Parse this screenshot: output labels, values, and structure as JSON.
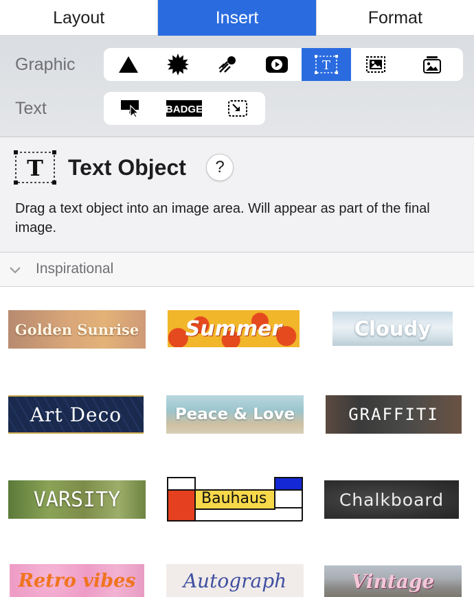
{
  "tabs": [
    {
      "label": "Layout",
      "active": false
    },
    {
      "label": "Insert",
      "active": true
    },
    {
      "label": "Format",
      "active": false
    }
  ],
  "toolbar": {
    "graphic_label": "Graphic",
    "text_label": "Text",
    "graphic_buttons": [
      {
        "icon": "triangle-shape-icon"
      },
      {
        "icon": "starburst-icon"
      },
      {
        "icon": "comet-icon"
      },
      {
        "icon": "play-video-icon"
      },
      {
        "icon": "text-object-icon",
        "selected": true
      },
      {
        "icon": "image-frame-icon"
      },
      {
        "icon": "photo-stack-icon"
      }
    ],
    "text_buttons": [
      {
        "icon": "callout-pointer-icon"
      },
      {
        "icon": "badge-icon",
        "text": "BADGE"
      },
      {
        "icon": "resize-box-icon"
      }
    ]
  },
  "info": {
    "title": "Text Object",
    "icon_glyph": "T",
    "help_label": "?",
    "description": "Drag a text object into an image area. Will appear as part of the final image."
  },
  "section": {
    "label": "Inspirational",
    "expanded": true
  },
  "styles": [
    {
      "label": "Golden Sunrise"
    },
    {
      "label": "Summer"
    },
    {
      "label": "Cloudy"
    },
    {
      "label": "Art Deco"
    },
    {
      "label": "Peace & Love"
    },
    {
      "label": "GRAFFITI"
    },
    {
      "label": "VARSITY"
    },
    {
      "label": "Bauhaus"
    },
    {
      "label": "Chalkboard"
    },
    {
      "label": "Retro vibes"
    },
    {
      "label": "Autograph"
    },
    {
      "label": "Vintage"
    }
  ],
  "colors": {
    "accent": "#2a6ce0",
    "toolbar_bg": "#dfe1e4",
    "info_bg": "#f2f2f4"
  }
}
